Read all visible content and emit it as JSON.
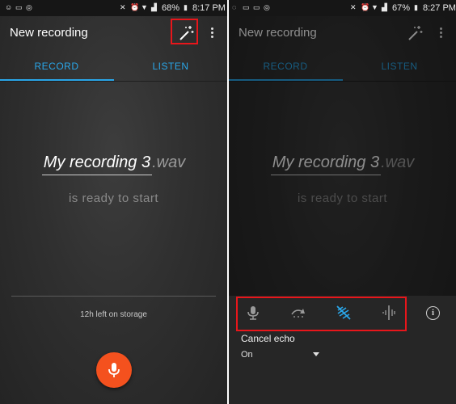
{
  "left": {
    "status": {
      "battery": "68%",
      "time": "8:17 PM"
    },
    "toolbar": {
      "title": "New recording"
    },
    "tabs": [
      {
        "label": "RECORD"
      },
      {
        "label": "LISTEN"
      }
    ],
    "recording": {
      "name": "My recording 3",
      "extension": ".wav",
      "subtitle": "is ready to start"
    },
    "storage": {
      "text": "12h left on storage"
    }
  },
  "right": {
    "status": {
      "battery": "67%",
      "time": "8:27 PM"
    },
    "toolbar": {
      "title": "New recording"
    },
    "tabs": [
      {
        "label": "RECORD"
      },
      {
        "label": "LISTEN"
      }
    ],
    "recording": {
      "name": "My recording 3",
      "extension": ".wav",
      "subtitle": "is ready to start"
    },
    "effects": {
      "icons": [
        "microphone-gain-icon",
        "redo-icon",
        "cancel-echo-icon",
        "noise-filter-icon",
        "info-icon"
      ],
      "selected_label": "Cancel echo",
      "selected_value": "On"
    }
  },
  "colors": {
    "accent": "#2aa6e8",
    "record": "#f4511e",
    "highlight": "#e8161b"
  }
}
